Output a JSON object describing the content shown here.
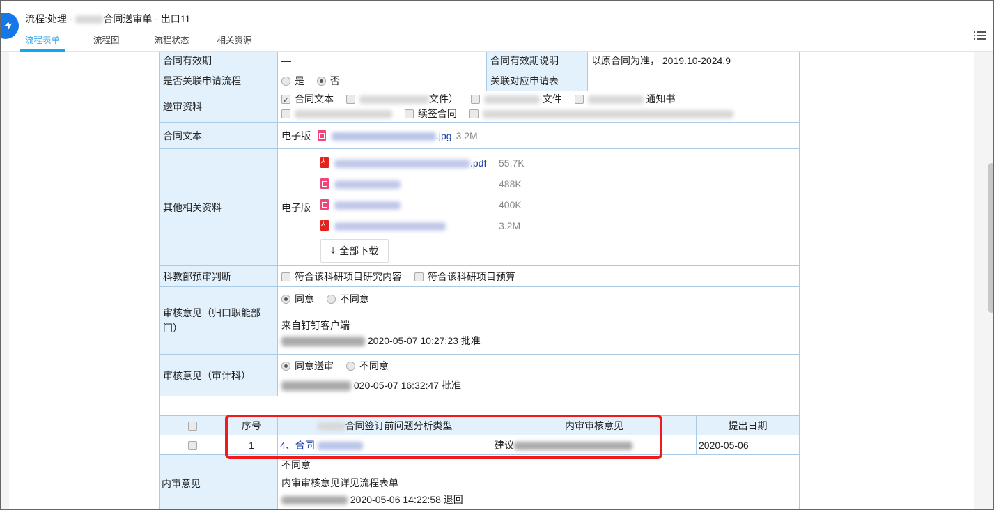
{
  "header": {
    "title_prefix": "流程:处理 - ",
    "title_suffix": "合同送审单 - 出口11",
    "tabs": [
      {
        "label": "流程表单",
        "active": true
      },
      {
        "label": "流程图",
        "active": false
      },
      {
        "label": "流程状态",
        "active": false
      },
      {
        "label": "相关资源",
        "active": false
      }
    ],
    "menu_icon": "list-menu-icon",
    "accent_color": "#10a6f0"
  },
  "form": {
    "validity": {
      "label": "合同有效期",
      "value": "—",
      "note_label": "合同有效期说明",
      "note_value": "以原合同为准， 2019.10-2024.9"
    },
    "linked_flow": {
      "label": "是否关联申请流程",
      "options": [
        "是",
        "否"
      ],
      "selected": "否",
      "linked_label": "关联对应申请表",
      "linked_value": ""
    },
    "materials": {
      "label": "送审资料",
      "row1": [
        {
          "label": "合同文本",
          "checked": true
        },
        {
          "label": "文件）",
          "checked": false
        },
        {
          "label": "文件",
          "checked": false
        },
        {
          "label": "通知书",
          "checked": false
        }
      ],
      "row2": [
        {
          "label": "",
          "checked": false
        },
        {
          "label": "续签合同",
          "checked": false
        },
        {
          "label": "",
          "checked": false
        }
      ]
    },
    "contract_text": {
      "label": "合同文本",
      "edition": "电子版",
      "files": [
        {
          "ext": ".jpg",
          "size": "3.2M",
          "type": "image"
        }
      ]
    },
    "other_materials": {
      "label": "其他相关资料",
      "edition": "电子版",
      "files": [
        {
          "ext": ".pdf",
          "size": "55.7K",
          "type": "pdf"
        },
        {
          "ext": "",
          "size": "488K",
          "type": "image"
        },
        {
          "ext": "",
          "size": "400K",
          "type": "image"
        },
        {
          "ext": "",
          "size": "3.2M",
          "type": "pdf"
        }
      ],
      "download_all": "全部下载"
    },
    "pre_review": {
      "label": "科教部预审判断",
      "options": [
        {
          "label": "符合该科研项目研究内容",
          "checked": false
        },
        {
          "label": "符合该科研项目预算",
          "checked": false
        }
      ]
    },
    "dept_opinion": {
      "label": "审核意见（归口职能部门）",
      "options": [
        "同意",
        "不同意"
      ],
      "selected": "同意",
      "source": "来自钉钉客户端",
      "sign": "2020-05-07 10:27:23 批准"
    },
    "audit_opinion": {
      "label": "审核意见（审计科）",
      "options": [
        "同意送审",
        "不同意"
      ],
      "selected": "同意送审",
      "sign": "020-05-07 16:32:47 批准"
    }
  },
  "issues_table": {
    "headers": [
      "",
      "序号",
      "合同签订前问题分析类型",
      "内审审核意见",
      "",
      "提出日期"
    ],
    "rows": [
      {
        "index": "1",
        "type": "4、合同",
        "opinion": "建议",
        "date": "2020-05-06"
      }
    ]
  },
  "internal_audit": {
    "label": "内审意见",
    "result": "不同意",
    "detail": "内审审核意见详见流程表单",
    "sign": "2020-05-06 14:22:58 退回"
  }
}
